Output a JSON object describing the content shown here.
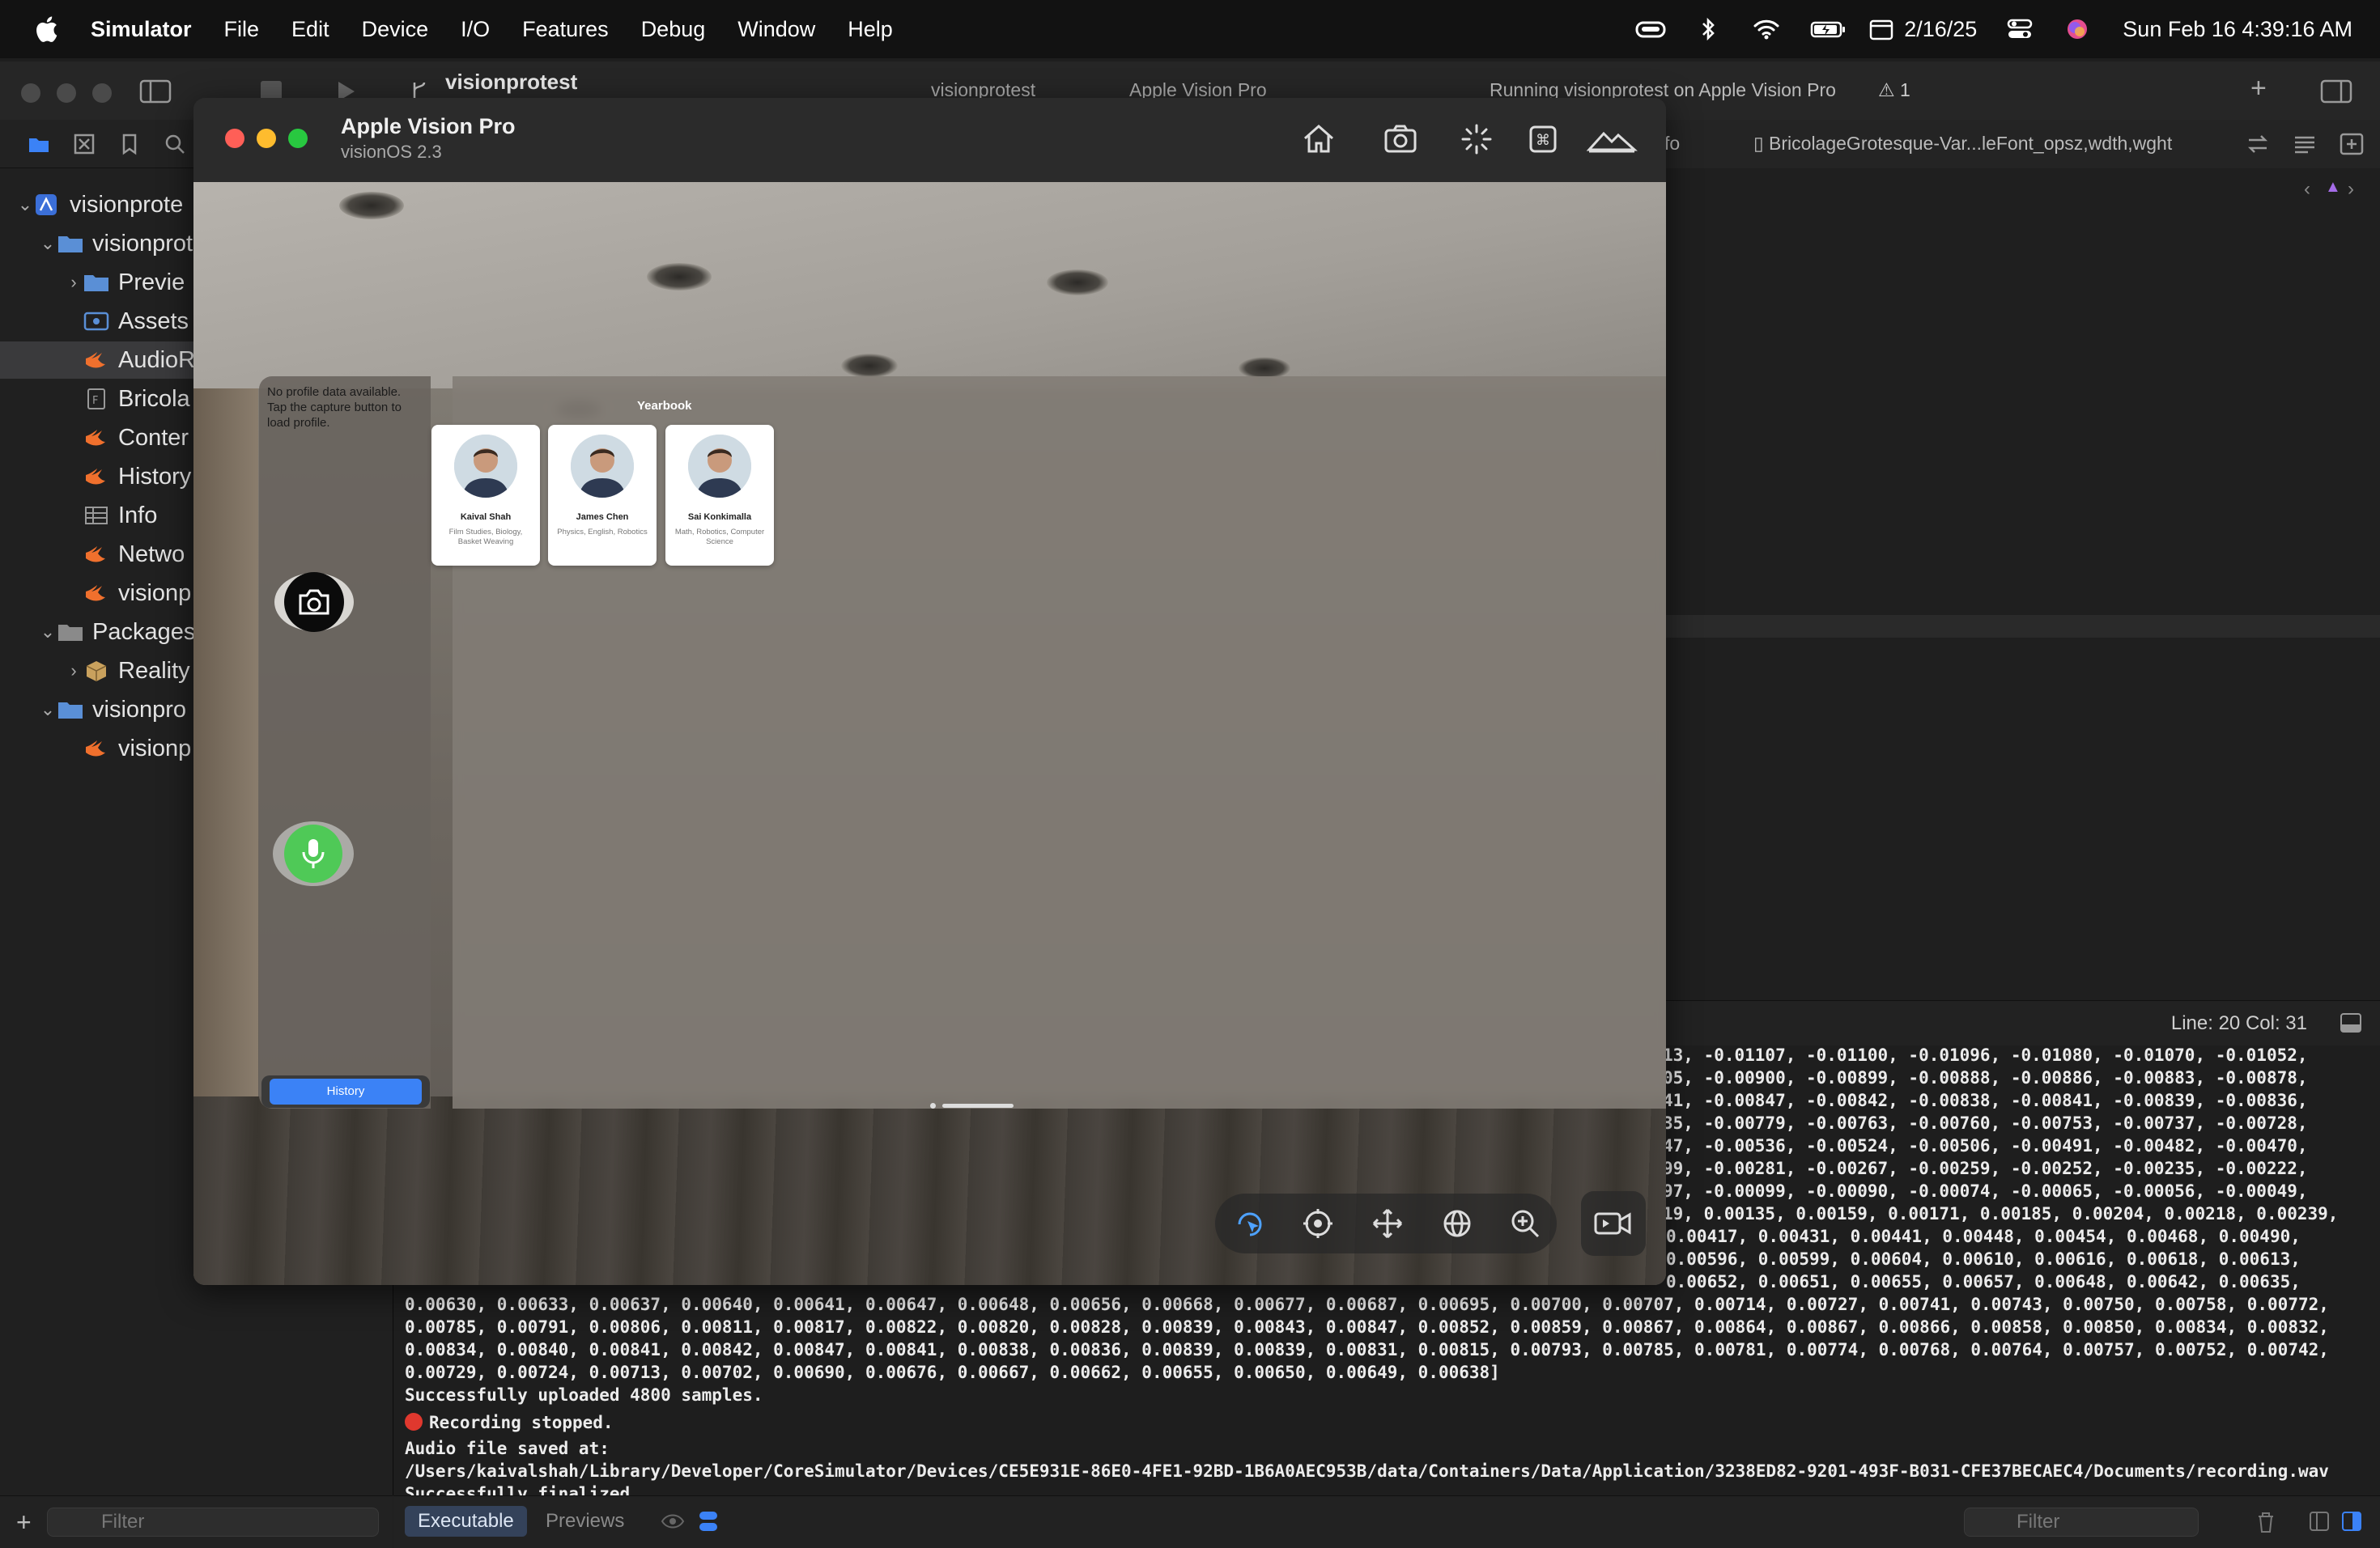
{
  "menubar": {
    "app_name": "Simulator",
    "items": [
      "File",
      "Edit",
      "Device",
      "I/O",
      "Features",
      "Debug",
      "Window",
      "Help"
    ],
    "date_badge": "2/16/25",
    "clock": "Sun Feb 16  4:39:16 AM"
  },
  "xcode": {
    "project": "visionprotest",
    "scheme": "visionprotest",
    "destination": "Apple Vision Pro",
    "status": "Running visionprotest on Apple Vision Pro",
    "warnings": "1",
    "tabs": {
      "partial_left": "fo",
      "font_file": "BricolageGrotesque-Var...leFont_opsz,wdth,wght"
    },
    "navigator": {
      "rows": [
        {
          "label": "visionprote",
          "icon": "project-icon"
        },
        {
          "label": "visionprot",
          "icon": "folder-icon"
        },
        {
          "label": "Previe",
          "icon": "folder-icon"
        },
        {
          "label": "Assets",
          "icon": "assets-icon"
        },
        {
          "label": "AudioR",
          "icon": "swift-icon"
        },
        {
          "label": "Bricola",
          "icon": "font-file-icon"
        },
        {
          "label": "Conter",
          "icon": "swift-icon"
        },
        {
          "label": "History",
          "icon": "swift-icon"
        },
        {
          "label": "Info",
          "icon": "plist-icon"
        },
        {
          "label": "Netwo",
          "icon": "swift-icon"
        },
        {
          "label": "visionp",
          "icon": "swift-icon"
        },
        {
          "label": "Packages",
          "icon": "folder-icon"
        },
        {
          "label": "Reality",
          "icon": "package-icon"
        },
        {
          "label": "visionpro",
          "icon": "folder-icon"
        },
        {
          "label": "visionp",
          "icon": "swift-icon"
        }
      ],
      "filter_placeholder": "Filter"
    },
    "line_col": "Line: 20  Col: 31",
    "console": {
      "lines": [
        "13, -0.01107, -0.01100, -0.01096, -0.01080, -0.01070, -0.01052,",
        "05, -0.00900, -0.00899, -0.00888, -0.00886, -0.00883, -0.00878,",
        "41, -0.00847, -0.00842, -0.00838, -0.00841, -0.00839, -0.00836,",
        "35, -0.00779, -0.00763, -0.00760, -0.00753, -0.00737, -0.00728,",
        "47, -0.00536, -0.00524, -0.00506, -0.00491, -0.00482, -0.00470,",
        "99, -0.00281, -0.00267, -0.00259, -0.00252, -0.00235, -0.00222,",
        "97, -0.00099, -0.00090, -0.00074, -0.00065, -0.00056, -0.00049,",
        "19, 0.00135, 0.00159, 0.00171, 0.00185, 0.00204, 0.00218, 0.00239,",
        "0.00417, 0.00431, 0.00441, 0.00448, 0.00454, 0.00468, 0.00490,",
        "0.00596, 0.00599, 0.00604, 0.00610, 0.00616, 0.00618, 0.00613,",
        "0.00652, 0.00651, 0.00655, 0.00657, 0.00648, 0.00642, 0.00635,",
        "0.00630, 0.00633, 0.00637, 0.00640, 0.00641, 0.00647, 0.00648, 0.00656, 0.00668, 0.00677, 0.00687, 0.00695, 0.00700, 0.00707, 0.00714, 0.00727, 0.00741, 0.00743, 0.00750, 0.00758, 0.00772,",
        "0.00785, 0.00791, 0.00806, 0.00811, 0.00817, 0.00822, 0.00820, 0.00828, 0.00839, 0.00843, 0.00847, 0.00852, 0.00859, 0.00867, 0.00864, 0.00867, 0.00866, 0.00858, 0.00850, 0.00834, 0.00832,",
        "0.00834, 0.00840, 0.00841, 0.00842, 0.00847, 0.00841, 0.00838, 0.00836, 0.00839, 0.00839, 0.00831, 0.00815, 0.00793, 0.00785, 0.00781, 0.00774, 0.00768, 0.00764, 0.00757, 0.00752, 0.00742,",
        "0.00729, 0.00724, 0.00713, 0.00702, 0.00690, 0.00676, 0.00667, 0.00662, 0.00655, 0.00650, 0.00649, 0.00638]",
        "Successfully uploaded 4800 samples."
      ],
      "recording_stopped": "Recording stopped.",
      "saved_at": "Audio file saved at:",
      "path": "/Users/kaivalshah/Library/Developer/CoreSimulator/Devices/CE5E931E-86E0-4FE1-92BD-1B6A0AEC953B/data/Containers/Data/Application/3238ED82-9201-493F-B031-CFE37BECAEC4/Documents/recording.wav",
      "finalized": "Successfully finalized.",
      "tab_executable": "Executable",
      "tab_previews": "Previews",
      "filter_placeholder": "Filter"
    }
  },
  "simulator": {
    "device": "Apple Vision Pro",
    "os": "visionOS 2.3",
    "app": {
      "side_note": "No profile data available. Tap the capture button to load profile.",
      "history_label": "History",
      "section_title": "Yearbook",
      "cards": [
        {
          "name": "Kaival Shah",
          "subjects": "Film Studies, Biology, Basket Weaving"
        },
        {
          "name": "James Chen",
          "subjects": "Physics, English, Robotics"
        },
        {
          "name": "Sai Konkimalla",
          "subjects": "Math, Robotics, Computer Science"
        }
      ]
    }
  }
}
